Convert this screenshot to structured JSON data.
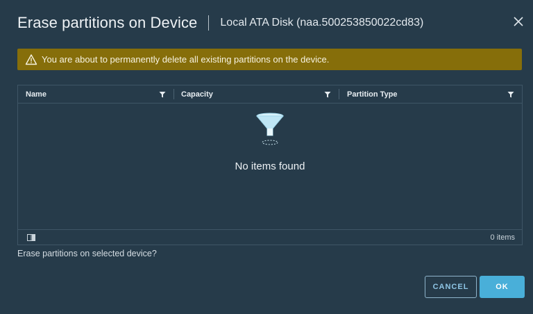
{
  "dialog": {
    "title": "Erase partitions on Device",
    "subtitle": "Local ATA Disk (naa.500253850022cd83)",
    "close_icon": "close-icon"
  },
  "warning": {
    "icon": "warning-triangle-icon",
    "text": "You are about to permanently delete all existing partitions on the device.",
    "bg_color": "#866e0a"
  },
  "grid": {
    "columns": [
      {
        "label": "Name",
        "filter_icon": "filter-icon"
      },
      {
        "label": "Capacity",
        "filter_icon": "filter-icon"
      },
      {
        "label": "Partition Type",
        "filter_icon": "filter-icon"
      }
    ],
    "empty_icon": "funnel-empty-icon",
    "empty_message": "No items found",
    "footer_count": "0 items",
    "column_toggle_icon": "column-toggle-icon"
  },
  "question": "Erase partitions on selected device?",
  "buttons": {
    "cancel_label": "CANCEL",
    "ok_label": "OK",
    "primary_color": "#49afd9"
  }
}
